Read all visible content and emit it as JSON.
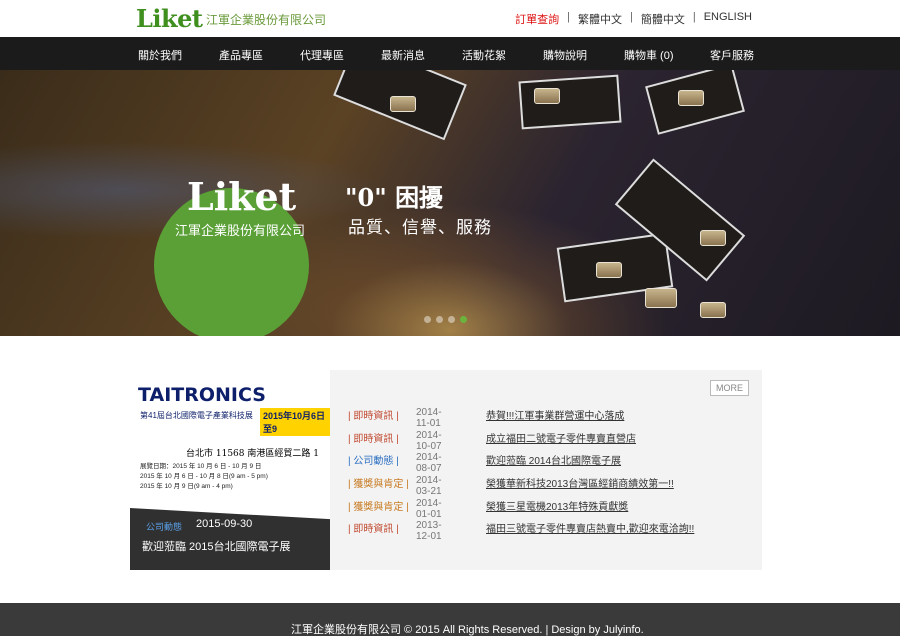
{
  "header": {
    "logo": "Liket",
    "company": "江軍企業股份有限公司",
    "links": [
      {
        "label": "訂單查詢",
        "highlight": true
      },
      {
        "label": "繁體中文"
      },
      {
        "label": "簡體中文"
      },
      {
        "label": "ENGLISH"
      }
    ]
  },
  "nav": {
    "items": [
      "關於我們",
      "產品專區",
      "代理專區",
      "最新消息",
      "活動花絮",
      "購物說明",
      "購物車 (0)",
      "客戶服務"
    ]
  },
  "banner": {
    "logo": "Liket",
    "company": "江軍企業股份有限公司",
    "slogan_title": "\"0\" 困擾",
    "slogan_sub": "品質、信譽、服務",
    "slide_count": 4,
    "active_slide": 4
  },
  "news": {
    "more": "MORE",
    "feature": {
      "brand": "TAITRONICS",
      "subtitle": "第41屆台北國際電子產業科技展",
      "badge": "2015年10月6日至9",
      "address": "台北市 11568 南港區經貿二路 1",
      "details": [
        "展覽日期：2015 年 10 月 6 日 - 10 月 9 日",
        "2015 年 10 月 6 日 - 10 月 8 日(9 am - 5 pm)",
        "2015 年 10 月 9 日(9 am - 4 pm)"
      ],
      "category": "公司動態",
      "date": "2015-09-30",
      "caption": "歡迎蒞臨 2015台北國際電子展"
    },
    "items": [
      {
        "category": "| 即時資訊 |",
        "date": "2014-11-01",
        "title": "恭賀!!!江軍事業群營運中心落成",
        "color": "red"
      },
      {
        "category": "| 即時資訊 |",
        "date": "2014-10-07",
        "title": "成立福田二號電子零件專賣直營店",
        "color": "red"
      },
      {
        "category": "| 公司動態 |",
        "date": "2014-08-07",
        "title": "歡迎蒞臨 2014台北國際電子展",
        "color": "blue"
      },
      {
        "category": "| 獲獎與肯定 |",
        "date": "2014-03-21",
        "title": "榮獲華新科技2013台灣區經銷商績效第一!!",
        "color": "orange"
      },
      {
        "category": "| 獲獎與肯定 |",
        "date": "2014-01-01",
        "title": "榮獲三星電機2013年特殊貢獻獎",
        "color": "orange"
      },
      {
        "category": "| 即時資訊 |",
        "date": "2013-12-01",
        "title": "福田三號電子零件專賣店熱賣中,歡迎來電洽詢!!",
        "color": "red"
      }
    ]
  },
  "footer": {
    "text": "江軍企業股份有限公司 © 2015 All Rights Reserved. | Design by Julyinfo."
  }
}
